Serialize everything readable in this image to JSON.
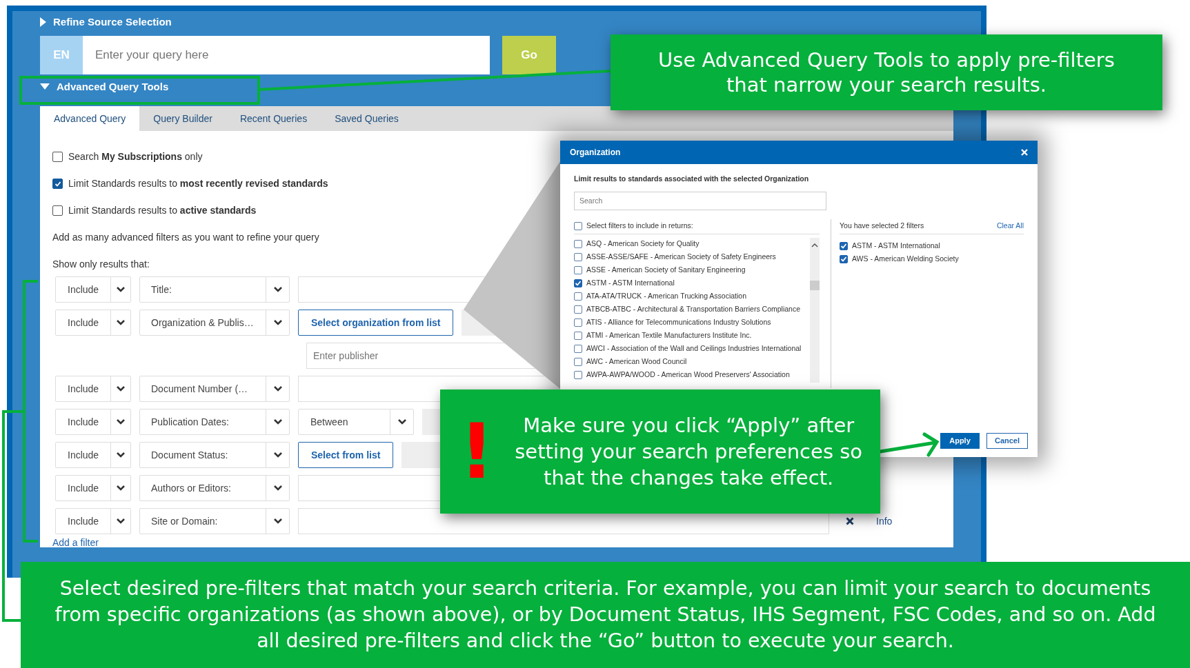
{
  "refine_source": {
    "label": "Refine Source Selection",
    "expanded": false
  },
  "search": {
    "language": "EN",
    "placeholder": "Enter your query here",
    "go": "Go"
  },
  "advanced_tools": {
    "label": "Advanced Query Tools",
    "expanded": true
  },
  "tabs": [
    {
      "label": "Advanced Query",
      "selected": true
    },
    {
      "label": "Query Builder",
      "selected": false
    },
    {
      "label": "Recent Queries",
      "selected": false
    },
    {
      "label": "Saved Queries",
      "selected": false
    }
  ],
  "options": [
    {
      "text": "Search **My Subscriptions** only",
      "checked": false
    },
    {
      "text": "Limit Standards results to **most recently revised standards**",
      "checked": true
    },
    {
      "text": "Limit Standards results to **active standards**",
      "checked": false
    }
  ],
  "hint": "Add as many advanced filters as you want to refine your query",
  "show_only": "Show only results that:",
  "filters": [
    {
      "mode": "Include",
      "field": "Title:",
      "kind": "text"
    },
    {
      "mode": "Include",
      "field": "Organization & Publis…",
      "kind": "button",
      "button": "Select organization from list",
      "placeholder": "Enter publisher"
    },
    {
      "mode": "Include",
      "field": "Document Number (…",
      "kind": "text"
    },
    {
      "mode": "Include",
      "field": "Publication Dates:",
      "kind": "select",
      "select": "Between"
    },
    {
      "mode": "Include",
      "field": "Document Status:",
      "kind": "button",
      "button": "Select from list"
    },
    {
      "mode": "Include",
      "field": "Authors or Editors:",
      "kind": "text"
    },
    {
      "mode": "Include",
      "field": "Site or Domain:",
      "kind": "text",
      "info": "Info"
    }
  ],
  "add_filter": "Add a filter",
  "modal": {
    "title": "Organization",
    "description": "Limit results to standards associated with the selected Organization",
    "search_placeholder": "Search",
    "select_all": {
      "label": "Select filters to include in returns:",
      "checked": false
    },
    "items": [
      {
        "label": "ASQ - American Society for Quality",
        "checked": false
      },
      {
        "label": "ASSE-ASSE/SAFE - American Society of Safety Engineers",
        "checked": false
      },
      {
        "label": "ASSE - American Society of Sanitary Engineering",
        "checked": false
      },
      {
        "label": "ASTM - ASTM International",
        "checked": true
      },
      {
        "label": "ATA-ATA/TRUCK - American Trucking Association",
        "checked": false
      },
      {
        "label": "ATBCB-ATBC - Architectural & Transportation Barriers Compliance",
        "checked": false
      },
      {
        "label": "ATIS - Alliance for Telecommunications Industry Solutions",
        "checked": false
      },
      {
        "label": "ATMI - American Textile Manufacturers Institute Inc.",
        "checked": false
      },
      {
        "label": "AWCI - Association of the Wall and Ceilings Industries International",
        "checked": false
      },
      {
        "label": "AWC - American Wood Council",
        "checked": false
      },
      {
        "label": "AWPA-AWPA/WOOD - American Wood Preservers' Association",
        "checked": false
      }
    ],
    "summary": "You have selected 2 filters",
    "clear_all": "Clear All",
    "selected": [
      {
        "label": "ASTM - ASTM International",
        "checked": true
      },
      {
        "label": "AWS - American Welding Society",
        "checked": true
      }
    ],
    "apply": "Apply",
    "cancel": "Cancel"
  },
  "callouts": [
    {
      "kind": "top",
      "text": "Use Advanced Query Tools to apply pre-filters that narrow your search results."
    },
    {
      "kind": "warning",
      "mark": "!",
      "text": "Make sure you click “Apply” after setting your search preferences so that the changes take effect."
    },
    {
      "kind": "banner",
      "text": "Select desired pre-filters that match your search criteria. For example, you can limit your search to documents from specific organizations (as shown above), or by Document Status, IHS Segment, FSC Codes, and so on. Add all desired pre-filters and click the “Go” button to execute your search."
    }
  ]
}
